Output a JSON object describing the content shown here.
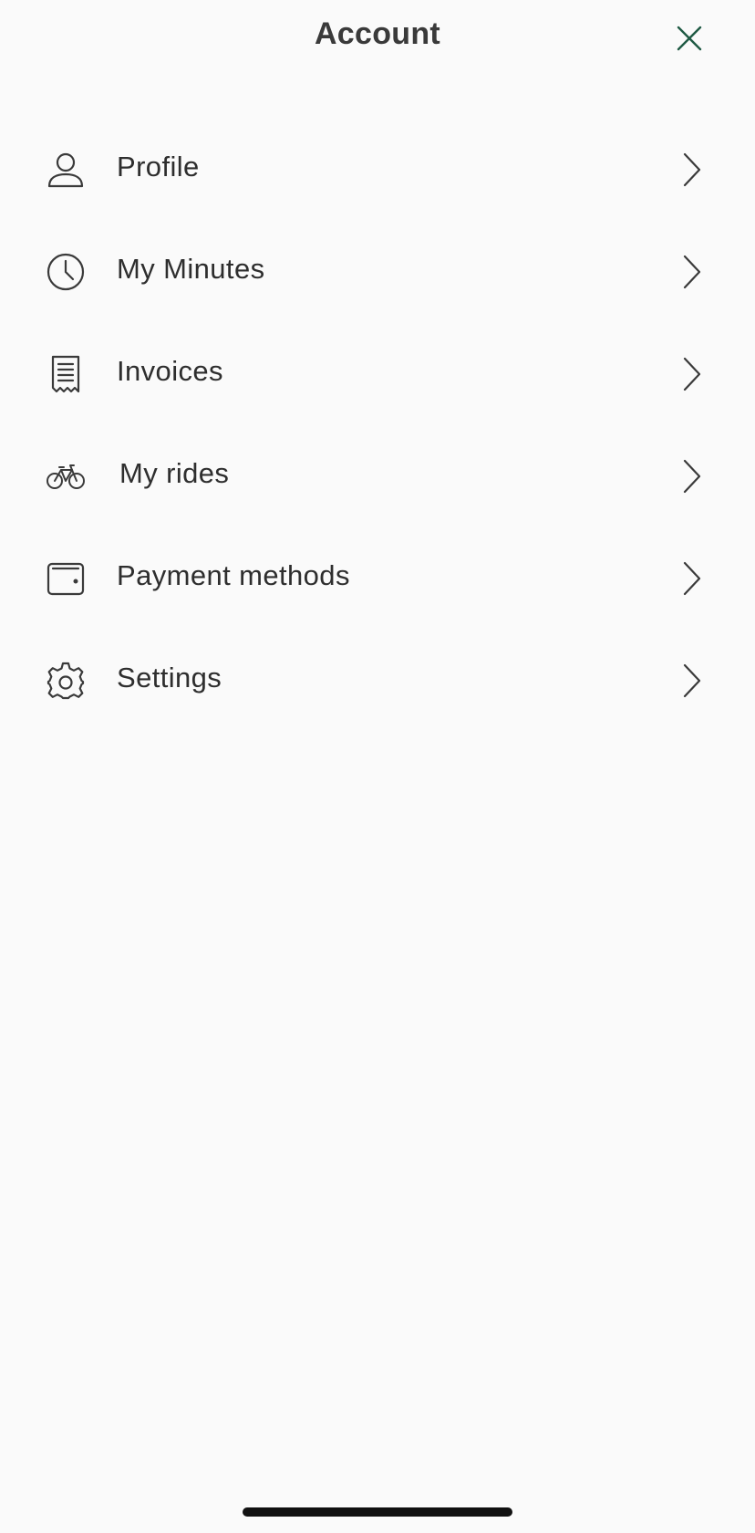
{
  "header": {
    "title": "Account",
    "close_icon": "close-icon",
    "accent_color": "#1f5a44"
  },
  "menu": {
    "items": [
      {
        "label": "Profile",
        "icon": "person-icon"
      },
      {
        "label": "My Minutes",
        "icon": "clock-icon"
      },
      {
        "label": "Invoices",
        "icon": "receipt-icon"
      },
      {
        "label": "My rides",
        "icon": "bicycle-icon"
      },
      {
        "label": "Payment methods",
        "icon": "wallet-icon"
      },
      {
        "label": "Settings",
        "icon": "gear-icon"
      }
    ],
    "chevron_icon": "chevron-right-icon"
  }
}
